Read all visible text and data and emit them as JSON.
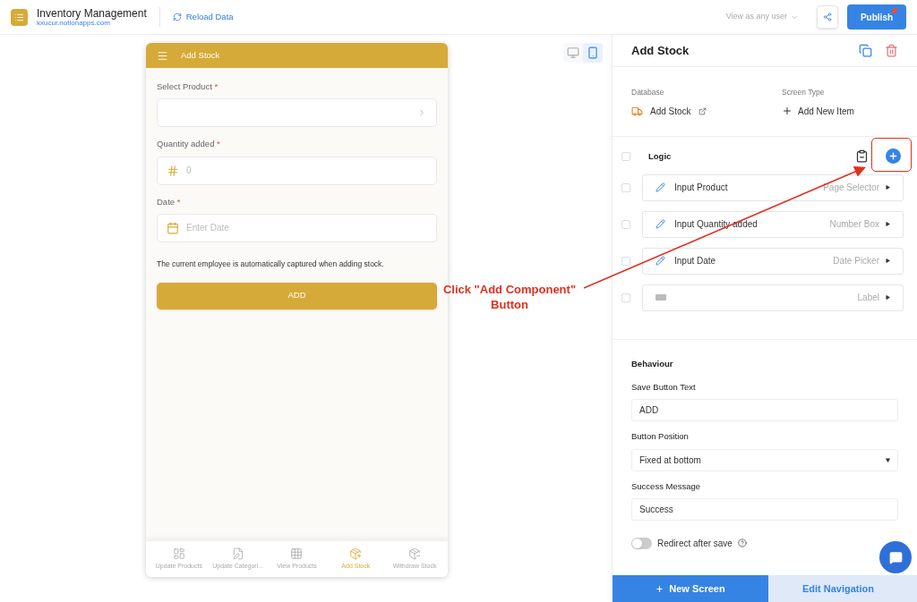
{
  "header": {
    "app_name": "Inventory Management",
    "app_url": "kxucur.notionapps.com",
    "reload": "Reload Data",
    "view_as": "View as any user",
    "publish": "Publish",
    "publish_badge": true
  },
  "device_toggle": [
    {
      "kind": "desktop",
      "selected": false
    },
    {
      "kind": "mobile",
      "selected": true
    }
  ],
  "phone": {
    "title": "Add Stock",
    "fields": [
      {
        "kind": "select",
        "label": "Select Product",
        "required_mark": "*"
      },
      {
        "kind": "number",
        "label": "Quantity added",
        "required_mark": "*",
        "placeholder": "0"
      },
      {
        "kind": "date",
        "label": "Date",
        "required_mark": "*",
        "placeholder": "Enter Date"
      }
    ],
    "note": "The current employee is automatically captured when adding stock.",
    "submit": "ADD",
    "tabs": [
      {
        "kind": "grid-check",
        "label": "Update Products",
        "selected": false
      },
      {
        "kind": "file-pen",
        "label": "Update Categori...",
        "selected": false
      },
      {
        "kind": "table",
        "label": "View Products",
        "selected": false
      },
      {
        "kind": "box-plus",
        "label": "Add Stock",
        "selected": true
      },
      {
        "kind": "box-minus",
        "label": "Withdraw Stock",
        "selected": false
      }
    ]
  },
  "panel": {
    "title": "Add Stock",
    "database_label": "Database",
    "database": "Add Stock",
    "screen_type_label": "Screen Type",
    "screen_type": "Add New Item",
    "logic": "Logic",
    "logic_checked": false,
    "components": [
      {
        "kind": "input",
        "name": "Input Product",
        "type": "Page Selector",
        "checked": false
      },
      {
        "kind": "input",
        "name": "Input Quantity added",
        "type": "Number Box",
        "checked": false
      },
      {
        "kind": "input",
        "name": "Input Date",
        "type": "Date Picker",
        "checked": false
      },
      {
        "kind": "label",
        "type": "Label",
        "checked": false
      }
    ],
    "behaviour": "Behaviour",
    "settings": [
      {
        "kind": "text",
        "label": "Save Button Text",
        "value": "ADD"
      },
      {
        "kind": "select",
        "label": "Button Position",
        "value": "Fixed at bottom"
      },
      {
        "kind": "text",
        "label": "Success Message",
        "value": "Success"
      }
    ],
    "redirect": {
      "label": "Redirect after save",
      "on": false
    },
    "new_screen": "New Screen",
    "edit_navigation": "Edit Navigation"
  },
  "annotation": {
    "lines": [
      "Click \"Add Component\"",
      "Button"
    ]
  }
}
